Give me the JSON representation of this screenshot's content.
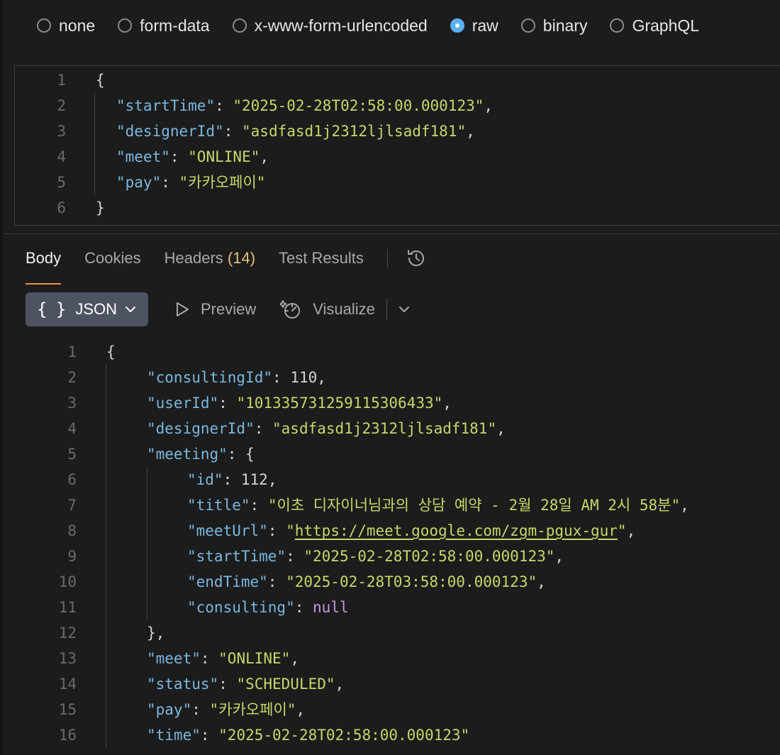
{
  "body_type": {
    "options": [
      {
        "label": "none",
        "selected": false
      },
      {
        "label": "form-data",
        "selected": false
      },
      {
        "label": "x-www-form-urlencoded",
        "selected": false
      },
      {
        "label": "raw",
        "selected": true
      },
      {
        "label": "binary",
        "selected": false
      },
      {
        "label": "GraphQL",
        "selected": false
      }
    ]
  },
  "request_body": {
    "lines": [
      {
        "n": "1",
        "indent": 0,
        "tokens": [
          {
            "t": "punc",
            "v": "{"
          }
        ]
      },
      {
        "n": "2",
        "indent": 1,
        "tokens": [
          {
            "t": "key",
            "v": "\"startTime\""
          },
          {
            "t": "punc",
            "v": ": "
          },
          {
            "t": "str",
            "v": "\"2025-02-28T02:58:00.000123\""
          },
          {
            "t": "punc",
            "v": ","
          }
        ]
      },
      {
        "n": "3",
        "indent": 1,
        "tokens": [
          {
            "t": "key",
            "v": "\"designerId\""
          },
          {
            "t": "punc",
            "v": ": "
          },
          {
            "t": "str",
            "v": "\"asdfasd1j2312ljlsadf181\""
          },
          {
            "t": "punc",
            "v": ","
          }
        ]
      },
      {
        "n": "4",
        "indent": 1,
        "tokens": [
          {
            "t": "key",
            "v": "\"meet\""
          },
          {
            "t": "punc",
            "v": ": "
          },
          {
            "t": "str",
            "v": "\"ONLINE\""
          },
          {
            "t": "punc",
            "v": ","
          }
        ]
      },
      {
        "n": "5",
        "indent": 1,
        "tokens": [
          {
            "t": "key",
            "v": "\"pay\""
          },
          {
            "t": "punc",
            "v": ": "
          },
          {
            "t": "str",
            "v": "\"카카오페이\""
          }
        ]
      },
      {
        "n": "6",
        "indent": 0,
        "tokens": [
          {
            "t": "punc",
            "v": "}"
          }
        ]
      }
    ]
  },
  "response": {
    "tabs": {
      "body": "Body",
      "cookies": "Cookies",
      "headers": "Headers",
      "headers_count": "(14)",
      "test_results": "Test Results"
    },
    "toolbar": {
      "format": "JSON",
      "preview": "Preview",
      "visualize": "Visualize"
    },
    "lines": [
      {
        "n": "1",
        "indent": 0,
        "tokens": [
          {
            "t": "punc",
            "v": "{"
          }
        ]
      },
      {
        "n": "2",
        "indent": 1,
        "tokens": [
          {
            "t": "key",
            "v": "\"consultingId\""
          },
          {
            "t": "punc",
            "v": ": "
          },
          {
            "t": "num",
            "v": "110"
          },
          {
            "t": "punc",
            "v": ","
          }
        ]
      },
      {
        "n": "3",
        "indent": 1,
        "tokens": [
          {
            "t": "key",
            "v": "\"userId\""
          },
          {
            "t": "punc",
            "v": ": "
          },
          {
            "t": "str",
            "v": "\"101335731259115306433\""
          },
          {
            "t": "punc",
            "v": ","
          }
        ]
      },
      {
        "n": "4",
        "indent": 1,
        "tokens": [
          {
            "t": "key",
            "v": "\"designerId\""
          },
          {
            "t": "punc",
            "v": ": "
          },
          {
            "t": "str",
            "v": "\"asdfasd1j2312ljlsadf181\""
          },
          {
            "t": "punc",
            "v": ","
          }
        ]
      },
      {
        "n": "5",
        "indent": 1,
        "tokens": [
          {
            "t": "key",
            "v": "\"meeting\""
          },
          {
            "t": "punc",
            "v": ": {"
          }
        ]
      },
      {
        "n": "6",
        "indent": 2,
        "tokens": [
          {
            "t": "key",
            "v": "\"id\""
          },
          {
            "t": "punc",
            "v": ": "
          },
          {
            "t": "num",
            "v": "112"
          },
          {
            "t": "punc",
            "v": ","
          }
        ]
      },
      {
        "n": "7",
        "indent": 2,
        "tokens": [
          {
            "t": "key",
            "v": "\"title\""
          },
          {
            "t": "punc",
            "v": ": "
          },
          {
            "t": "str",
            "v": "\"이초 디자이너님과의 상담 예약 - 2월 28일 AM 2시 58분\""
          },
          {
            "t": "punc",
            "v": ","
          }
        ]
      },
      {
        "n": "8",
        "indent": 2,
        "tokens": [
          {
            "t": "key",
            "v": "\"meetUrl\""
          },
          {
            "t": "punc",
            "v": ": "
          },
          {
            "t": "str",
            "v": "\""
          },
          {
            "t": "url",
            "v": "https://meet.google.com/zgm-pgux-gur"
          },
          {
            "t": "str",
            "v": "\""
          },
          {
            "t": "punc",
            "v": ","
          }
        ]
      },
      {
        "n": "9",
        "indent": 2,
        "tokens": [
          {
            "t": "key",
            "v": "\"startTime\""
          },
          {
            "t": "punc",
            "v": ": "
          },
          {
            "t": "str",
            "v": "\"2025-02-28T02:58:00.000123\""
          },
          {
            "t": "punc",
            "v": ","
          }
        ]
      },
      {
        "n": "10",
        "indent": 2,
        "tokens": [
          {
            "t": "key",
            "v": "\"endTime\""
          },
          {
            "t": "punc",
            "v": ": "
          },
          {
            "t": "str",
            "v": "\"2025-02-28T03:58:00.000123\""
          },
          {
            "t": "punc",
            "v": ","
          }
        ]
      },
      {
        "n": "11",
        "indent": 2,
        "tokens": [
          {
            "t": "key",
            "v": "\"consulting\""
          },
          {
            "t": "punc",
            "v": ": "
          },
          {
            "t": "null",
            "v": "null"
          }
        ]
      },
      {
        "n": "12",
        "indent": 1,
        "tokens": [
          {
            "t": "punc",
            "v": "},"
          }
        ]
      },
      {
        "n": "13",
        "indent": 1,
        "tokens": [
          {
            "t": "key",
            "v": "\"meet\""
          },
          {
            "t": "punc",
            "v": ": "
          },
          {
            "t": "str",
            "v": "\"ONLINE\""
          },
          {
            "t": "punc",
            "v": ","
          }
        ]
      },
      {
        "n": "14",
        "indent": 1,
        "tokens": [
          {
            "t": "key",
            "v": "\"status\""
          },
          {
            "t": "punc",
            "v": ": "
          },
          {
            "t": "str",
            "v": "\"SCHEDULED\""
          },
          {
            "t": "punc",
            "v": ","
          }
        ]
      },
      {
        "n": "15",
        "indent": 1,
        "tokens": [
          {
            "t": "key",
            "v": "\"pay\""
          },
          {
            "t": "punc",
            "v": ": "
          },
          {
            "t": "str",
            "v": "\"카카오페이\""
          },
          {
            "t": "punc",
            "v": ","
          }
        ]
      },
      {
        "n": "16",
        "indent": 1,
        "tokens": [
          {
            "t": "key",
            "v": "\"time\""
          },
          {
            "t": "punc",
            "v": ": "
          },
          {
            "t": "str",
            "v": "\"2025-02-28T02:58:00.000123\""
          }
        ]
      }
    ]
  }
}
